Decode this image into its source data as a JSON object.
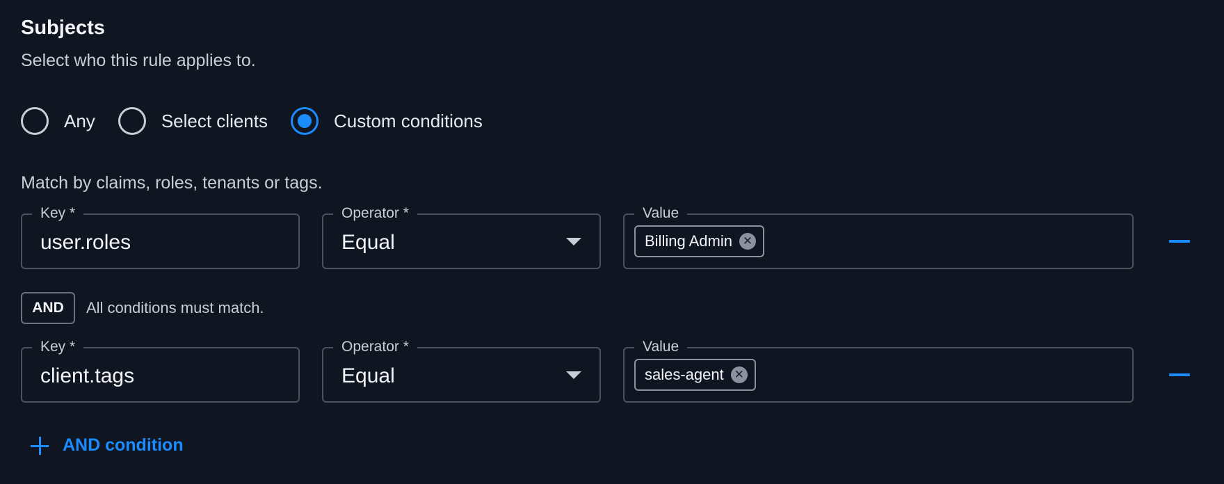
{
  "section": {
    "title": "Subjects",
    "description": "Select who this rule applies to."
  },
  "subject_options": [
    {
      "label": "Any",
      "selected": false
    },
    {
      "label": "Select clients",
      "selected": false
    },
    {
      "label": "Custom conditions",
      "selected": true
    }
  ],
  "match_hint": "Match by claims, roles, tenants or tags.",
  "conditions": [
    {
      "key_label": "Key *",
      "key_value": "user.roles",
      "operator_label": "Operator *",
      "operator_value": "Equal",
      "value_label": "Value",
      "chips": [
        "Billing Admin"
      ]
    },
    {
      "key_label": "Key *",
      "key_value": "client.tags",
      "operator_label": "Operator *",
      "operator_value": "Equal",
      "value_label": "Value",
      "chips": [
        "sales-agent"
      ]
    }
  ],
  "combinator": {
    "badge": "AND",
    "note": "All conditions must match."
  },
  "add_condition_label": "AND condition",
  "icons": {
    "chip_remove": "close-circle-icon",
    "row_remove": "minus-icon",
    "add": "plus-icon",
    "dropdown": "chevron-down-icon"
  },
  "colors": {
    "background": "#0f1621",
    "accent": "#1a8cff",
    "border": "#4a525e"
  }
}
